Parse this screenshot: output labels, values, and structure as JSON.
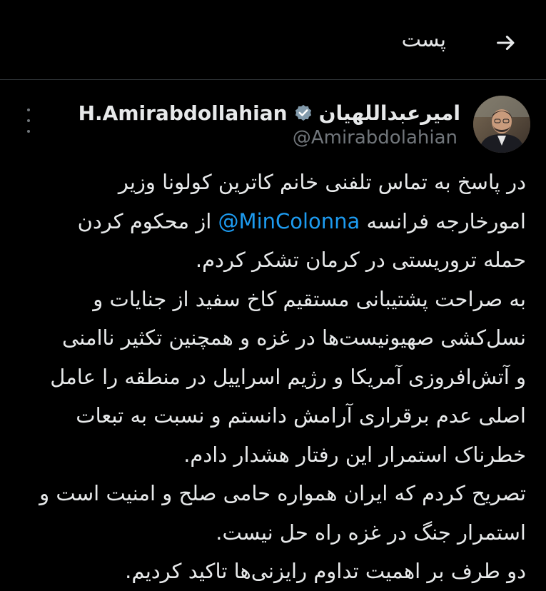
{
  "header": {
    "title": "پست",
    "back_icon": "arrow-right-icon"
  },
  "author": {
    "display_name_fa": "امیرعبداللهیان",
    "display_name_en": "H.Amirabdollahian",
    "handle": "@Amirabdolahian",
    "verified_icon": "verified-badge-icon",
    "verified_color": "#829aab"
  },
  "more_icon": "more-vertical-icon",
  "tweet": {
    "line_1": "در پاسخ به تماس تلفنی خانم کاترین کولونا وزیر",
    "line_2_before": "امورخارجه فرانسه ",
    "line_2_mention": "@MinColonna",
    "line_2_after": " از محکوم کردن",
    "line_3": "حمله تروریستی در کرمان تشکر کردم.",
    "line_4": "به صراحت پشتیبانی مستقیم کاخ سفید از جنایات و",
    "line_5": "نسل‌کشی صهیونیست‌ها در غزه و همچنین تکثیر ناامنی",
    "line_6": "و آتش‌افروزی آمریکا و رژیم اسراییل در منطقه را عامل",
    "line_7": "اصلی عدم برقراری آرامش دانستم و نسبت به تبعات",
    "line_8": "خطرناک استمرار این رفتار هشدار دادم.",
    "line_9": "تصریح کردم که ایران همواره حامی صلح و امنیت است و",
    "line_10": "استمرار جنگ در غزه راه حل نیست.",
    "line_11": "دو طرف بر اهمیت تداوم رایزنی‌ها تاکید کردیم."
  },
  "colors": {
    "background": "#000000",
    "text": "#e7e9ea",
    "secondary": "#71767b",
    "link": "#1d9bf0",
    "divider": "#2f3336"
  }
}
